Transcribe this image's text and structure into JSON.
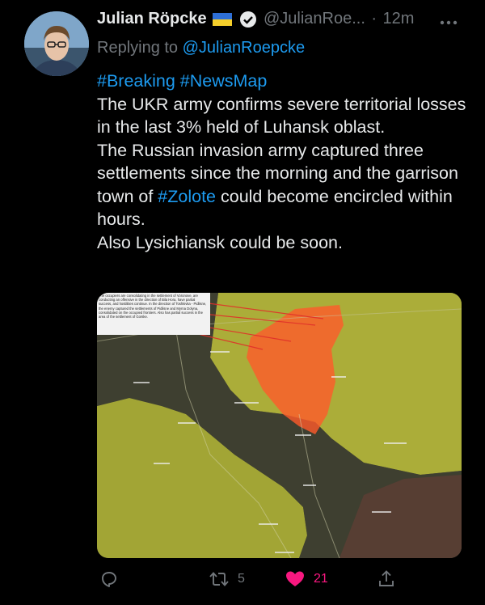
{
  "author": {
    "display_name": "Julian Röpcke",
    "handle": "@JulianRoe...",
    "timestamp": "12m",
    "dot": "·"
  },
  "reply": {
    "prefix": "Replying to",
    "target": "@JulianRoepcke"
  },
  "tweet": {
    "hashtags": "#Breaking #NewsMap",
    "line1": "The UKR army confirms severe territorial losses in the last 3% held of Luhansk oblast.",
    "line2_before": "The Russian invasion army captured three settlements since the morning and the garrison town of ",
    "line2_link": "#Zolote",
    "line2_after": " could become encircled within hours.",
    "line3": "Also Lysichiansk could be soon."
  },
  "media": {
    "note_text": "The occupiers are consolidating in the settlement of Voronove, are conducting an offensive in the direction of Bila Hora, have partial success, and hostilities continue. In the direction of Toshkivka - Pidlisne, the enemy captured the settlements of Pidlisne and Myrna Dolyna, consolidated on the occupied frontiers. Also has partial success in the area of the settlement of Gorske.",
    "colors": {
      "ukraine_controlled": "#b9b93a",
      "russia_controlled": "#5a4a3a",
      "advance_zone": "#ff5a2a"
    }
  },
  "actions": {
    "retweets": "5",
    "likes": "21"
  },
  "colors": {
    "link": "#1d9bf0",
    "muted": "#71767b",
    "like": "#f91880"
  }
}
